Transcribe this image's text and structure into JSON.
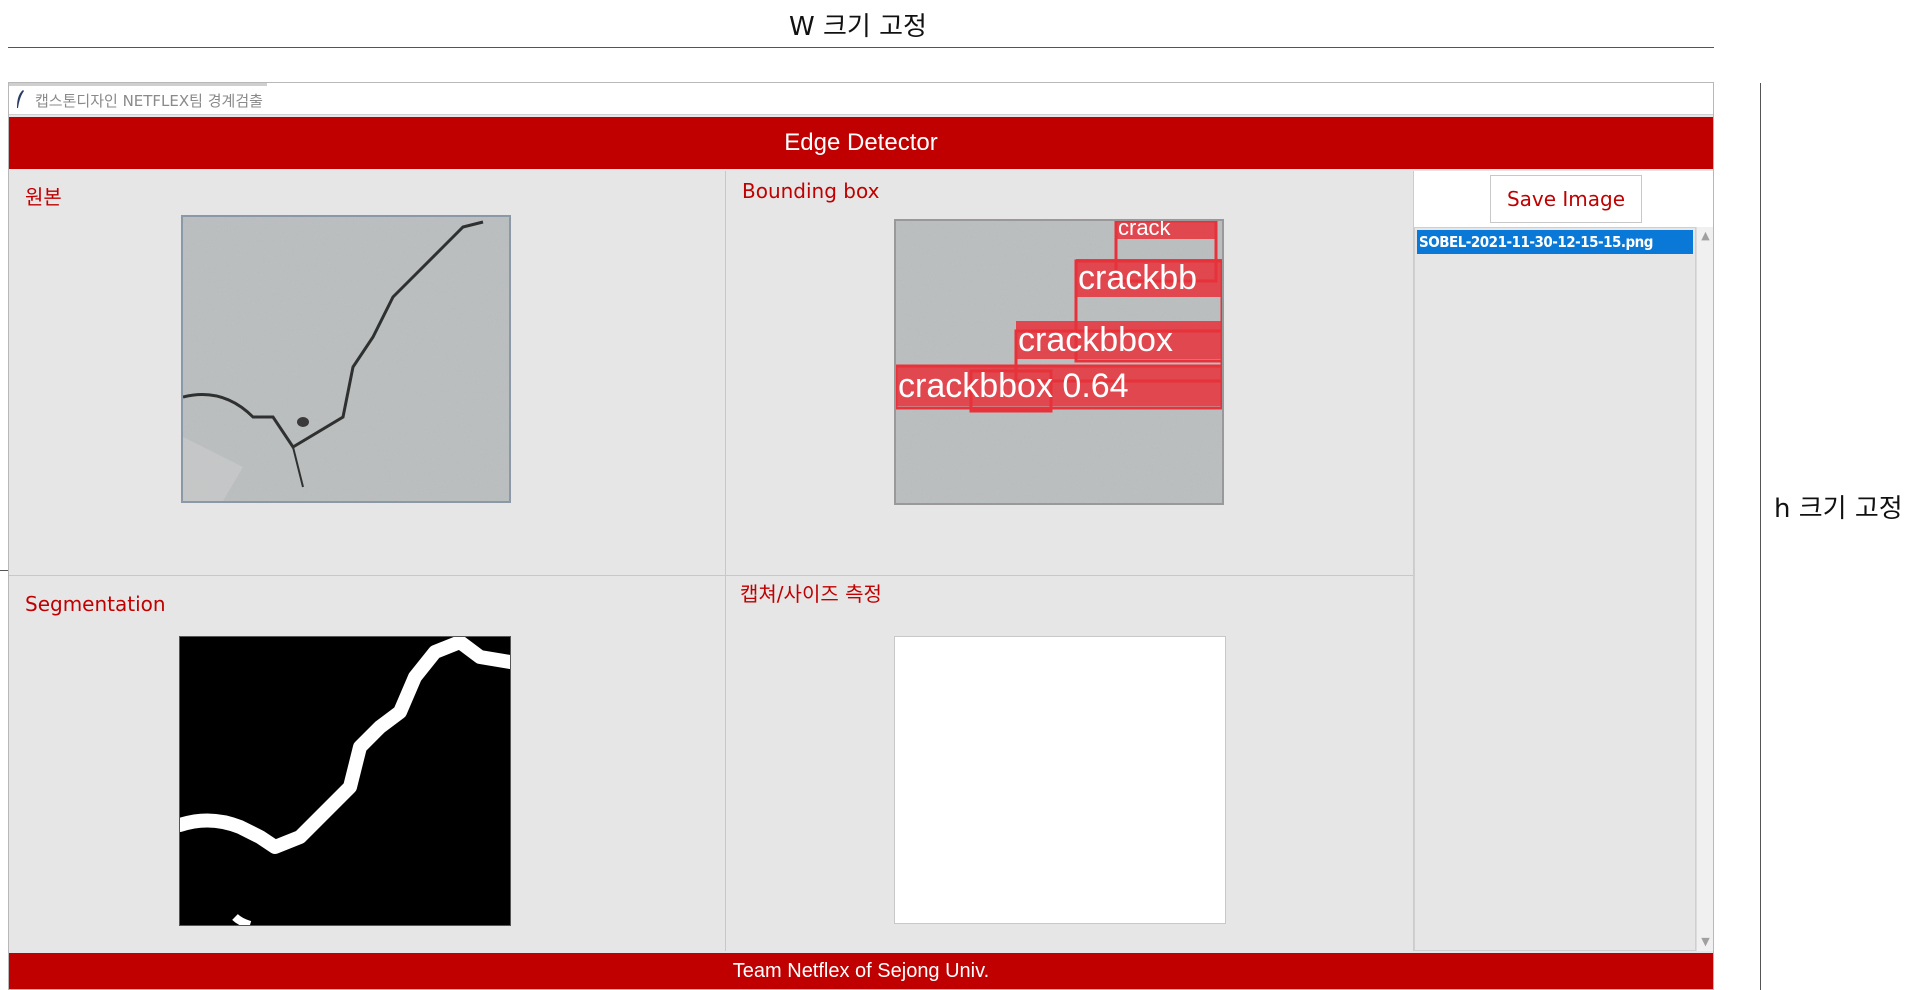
{
  "annotations": {
    "width_label": "W 크기 고정",
    "height_label": "h 크기 고정"
  },
  "window": {
    "title": "캡스톤디자인 NETFLEX팀 경계검출",
    "icon": "feather-icon"
  },
  "header": {
    "title": "Edge Detector"
  },
  "panels": {
    "original": {
      "label": "원본"
    },
    "bounding_box": {
      "label": "Bounding box",
      "detections": [
        "crack",
        "crackbb",
        "crackbbox",
        "crackbbox 0.64"
      ]
    },
    "segmentation": {
      "label": "Segmentation"
    },
    "capture": {
      "label": "캡쳐/사이즈 측정"
    }
  },
  "sidebar": {
    "save_button": "Save Image",
    "files": [
      "SOBEL-2021-11-30-12-15-15.png"
    ],
    "scroll_up_icon": "▲",
    "scroll_down_icon": "▼"
  },
  "footer": {
    "text": "Team Netflex of Sejong Univ."
  },
  "colors": {
    "accent": "#c00000",
    "selection": "#0a78d7",
    "panel_bg": "#e6e6e6"
  }
}
